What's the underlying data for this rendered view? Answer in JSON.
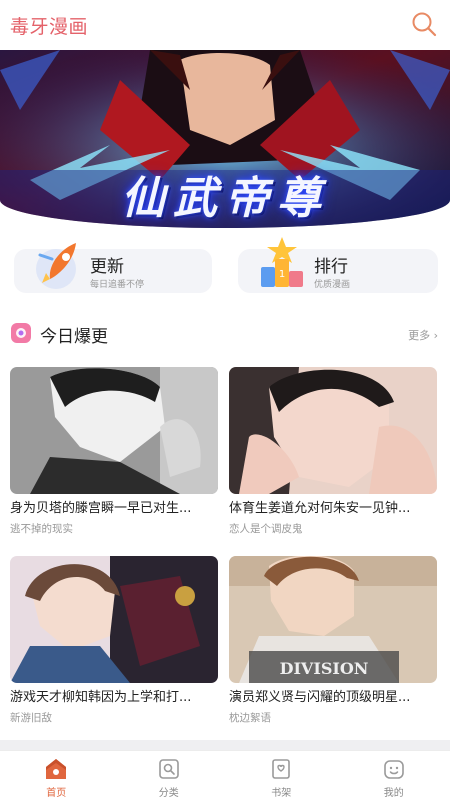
{
  "header": {
    "app_title": "毒牙漫画"
  },
  "banner": {
    "title": "仙武帝尊"
  },
  "quick_links": [
    {
      "title": "更新",
      "subtitle": "每日追番不停"
    },
    {
      "title": "排行",
      "subtitle": "优质漫画"
    }
  ],
  "section": {
    "title": "今日爆更",
    "more": "更多 ›"
  },
  "comics": [
    {
      "title": "身为贝塔的滕宫瞬一早已对生...",
      "author": "逃不掉的现实"
    },
    {
      "title": "体育生姜道允对何朱安一见钟...",
      "author": "恋人是个调皮鬼"
    },
    {
      "title": "游戏天才柳知韩因为上学和打...",
      "author": "新游旧敌"
    },
    {
      "title": "演员郑义贤与闪耀的顶级明星...",
      "author": "枕边絮语"
    }
  ],
  "nav": [
    {
      "label": "首页",
      "icon": "home-icon",
      "active": true
    },
    {
      "label": "分类",
      "icon": "category-icon",
      "active": false
    },
    {
      "label": "书架",
      "icon": "bookshelf-icon",
      "active": false
    },
    {
      "label": "我的",
      "icon": "profile-icon",
      "active": false
    }
  ],
  "colors": {
    "brand": "#e4626a",
    "active_nav": "#e0663e",
    "muted_text": "#999999"
  }
}
